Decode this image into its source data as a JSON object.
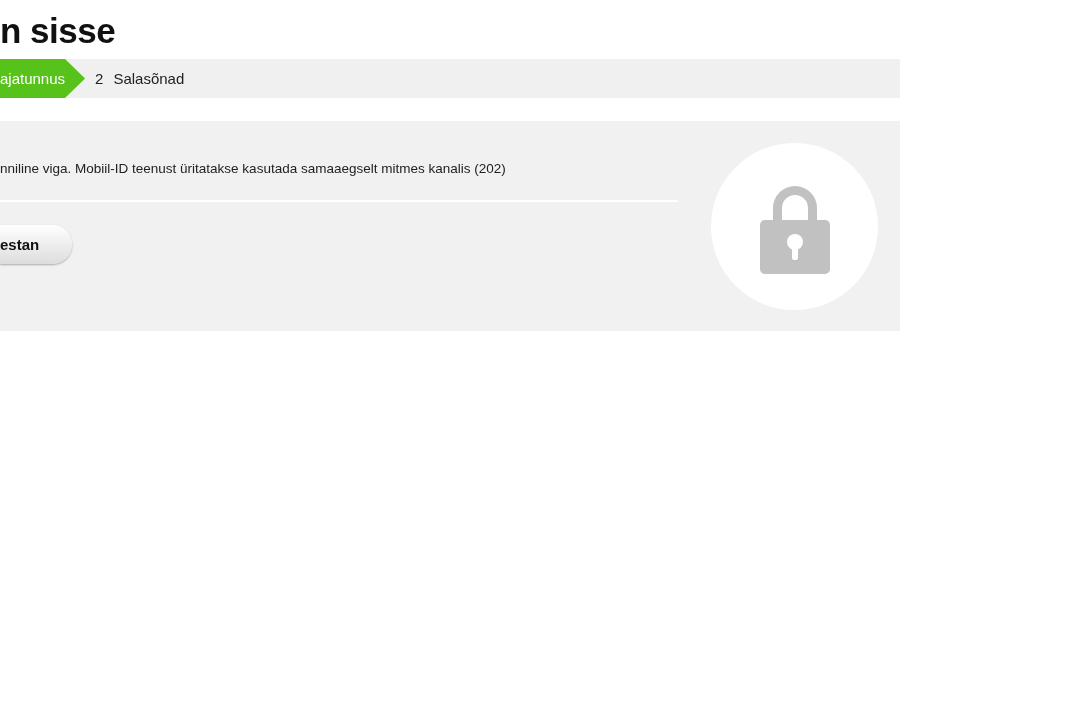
{
  "title": "n sisse",
  "steps": [
    {
      "label": "ajatunnus",
      "selected": true
    },
    {
      "number": "2",
      "label": "Salasõnad",
      "selected": false
    }
  ],
  "error": {
    "message": "nniline viga. Mobiil-ID teenust üritatakse kasutada samaaegselt mitmes kanalis (202)"
  },
  "button": {
    "label": "estan"
  }
}
